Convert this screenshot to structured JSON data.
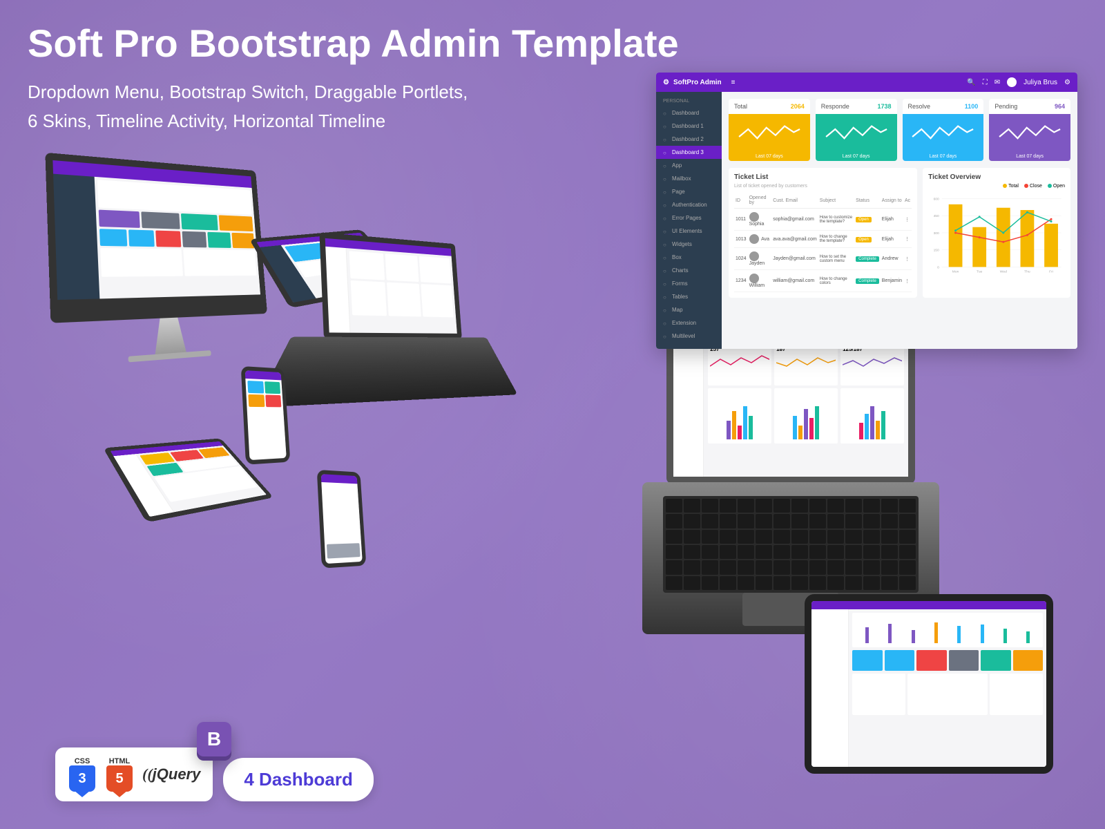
{
  "header": {
    "title": "Soft Pro Bootstrap Admin Template",
    "sub1": "Dropdown Menu, Bootstrap Switch, Draggable Portlets,",
    "sub2": "6 Skins, Timeline Activity, Horizontal Timeline"
  },
  "dashboard": {
    "brand": "SoftPro Admin",
    "user": "Juliya Brus",
    "sidebar_label": "PERSONAL",
    "sidebar": [
      {
        "label": "Dashboard",
        "active": false
      },
      {
        "label": "Dashboard 1",
        "active": false
      },
      {
        "label": "Dashboard 2",
        "active": false
      },
      {
        "label": "Dashboard 3",
        "active": true
      },
      {
        "label": "App",
        "active": false
      },
      {
        "label": "Mailbox",
        "active": false
      },
      {
        "label": "Page",
        "active": false
      },
      {
        "label": "Authentication",
        "active": false
      },
      {
        "label": "Error Pages",
        "active": false
      },
      {
        "label": "UI Elements",
        "active": false
      },
      {
        "label": "Widgets",
        "active": false
      },
      {
        "label": "Box",
        "active": false
      },
      {
        "label": "Charts",
        "active": false
      },
      {
        "label": "Forms",
        "active": false
      },
      {
        "label": "Tables",
        "active": false
      },
      {
        "label": "Map",
        "active": false
      },
      {
        "label": "Extension",
        "active": false
      },
      {
        "label": "Multilevel",
        "active": false
      }
    ],
    "stats": [
      {
        "label": "Total",
        "value": "2064",
        "color": "yellow",
        "foot": "Last 07 days"
      },
      {
        "label": "Responde",
        "value": "1738",
        "color": "teal",
        "foot": "Last 07 days"
      },
      {
        "label": "Resolve",
        "value": "1100",
        "color": "blue",
        "foot": "Last 07 days"
      },
      {
        "label": "Pending",
        "value": "964",
        "color": "purple",
        "foot": "Last 07 days"
      }
    ],
    "ticket_list": {
      "title": "Ticket List",
      "subtitle": "List of ticket opened by customers",
      "cols": [
        "ID",
        "Opened by",
        "Cust. Email",
        "Subject",
        "Status",
        "Assign to",
        "Ac"
      ],
      "rows": [
        {
          "id": "1011",
          "name": "Sophia",
          "email": "sophia@gmail.com",
          "subj": "How to customize the template?",
          "status": "Open",
          "assign": "Elijah"
        },
        {
          "id": "1013",
          "name": "Ava",
          "email": "ava.ava@gmail.com",
          "subj": "How to change the template?",
          "status": "Open",
          "assign": "Elijah"
        },
        {
          "id": "1024",
          "name": "Jayden",
          "email": "Jayden@gmail.com",
          "subj": "How to set the custom menu",
          "status": "Complete",
          "assign": "Andrew"
        },
        {
          "id": "1234",
          "name": "William",
          "email": "william@gmail.com",
          "subj": "How to change colors",
          "status": "Complete",
          "assign": "Benjamin"
        }
      ]
    },
    "ticket_overview": {
      "title": "Ticket Overview",
      "legend": [
        {
          "label": "Total",
          "color": "#f5b800"
        },
        {
          "label": "Close",
          "color": "#f44336"
        },
        {
          "label": "Open",
          "color": "#1abc9c"
        }
      ],
      "xlabels": [
        "Mon",
        "Tue",
        "Wed",
        "Thu",
        "Fri"
      ]
    }
  },
  "chart_data": {
    "type": "bar",
    "title": "Ticket Overview",
    "categories": [
      "Mon",
      "Tue",
      "Wed",
      "Thu",
      "Fri"
    ],
    "ylim": [
      0,
      600
    ],
    "series": [
      {
        "name": "Total",
        "type": "bar",
        "color": "#f5b800",
        "values": [
          550,
          350,
          520,
          500,
          380
        ]
      },
      {
        "name": "Close",
        "type": "line",
        "color": "#f44336",
        "values": [
          300,
          260,
          220,
          280,
          420
        ]
      },
      {
        "name": "Open",
        "type": "line",
        "color": "#1abc9c",
        "values": [
          320,
          440,
          300,
          480,
          400
        ]
      }
    ]
  },
  "stat_cards_mockup": {
    "values": [
      "257",
      "187",
      "125/187"
    ]
  },
  "footer": {
    "css_label": "CSS",
    "css_num": "3",
    "html_label": "HTML",
    "html_num": "5",
    "jquery": "jQuery",
    "bootstrap": "B",
    "pill": "4 Dashboard"
  }
}
